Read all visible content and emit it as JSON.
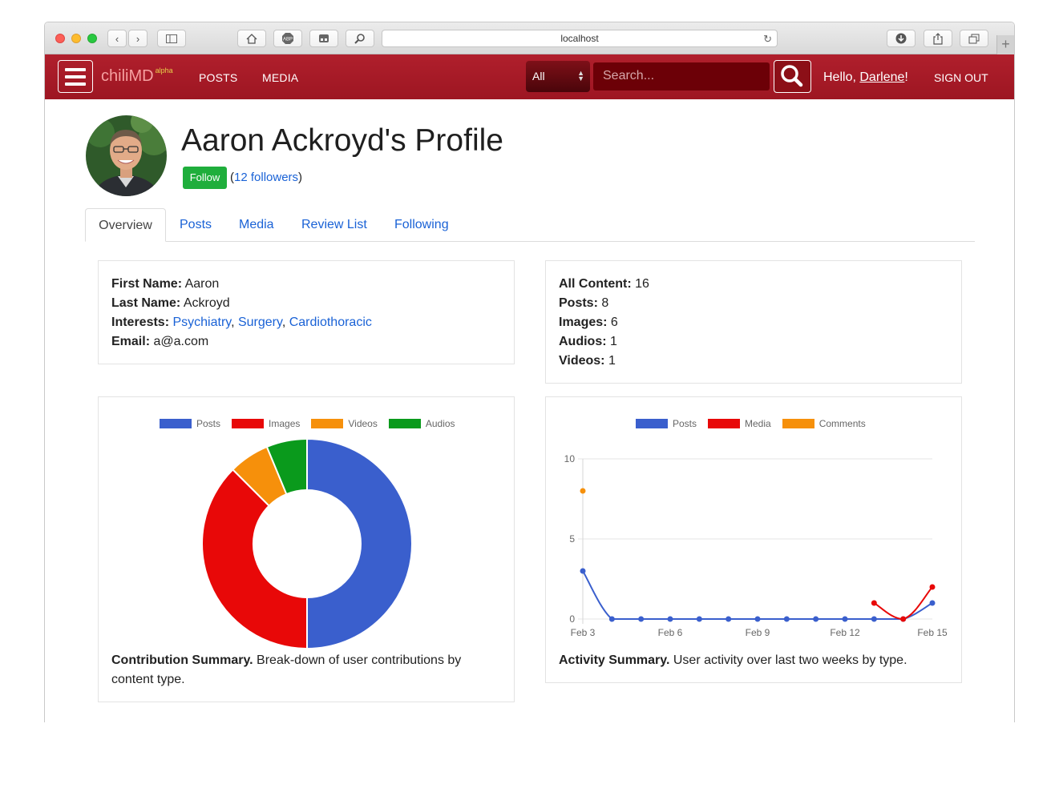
{
  "browser": {
    "url": "localhost"
  },
  "nav": {
    "brand": "chiliMD",
    "brand_tag": "alpha",
    "links": [
      "POSTS",
      "MEDIA"
    ],
    "filter": "All",
    "search_placeholder": "Search...",
    "hello_prefix": "Hello, ",
    "user": "Darlene",
    "hello_suffix": "!",
    "signout": "SIGN OUT",
    "color": "#a91b27"
  },
  "profile": {
    "title": "Aaron Ackroyd's Profile",
    "follow_label": "Follow",
    "followers_link": "12 followers"
  },
  "tabs": [
    "Overview",
    "Posts",
    "Media",
    "Review List",
    "Following"
  ],
  "details": {
    "first_name_label": "First Name:",
    "first_name": "Aaron",
    "last_name_label": "Last Name:",
    "last_name": "Ackroyd",
    "interests_label": "Interests:",
    "interests": [
      "Psychiatry",
      "Surgery",
      "Cardiothoracic"
    ],
    "email_label": "Email:",
    "email": "a@a.com"
  },
  "stats": [
    {
      "label": "All Content:",
      "value": "16"
    },
    {
      "label": "Posts:",
      "value": "8"
    },
    {
      "label": "Images:",
      "value": "6"
    },
    {
      "label": "Audios:",
      "value": "1"
    },
    {
      "label": "Videos:",
      "value": "1"
    }
  ],
  "captions": {
    "contribution_bold": "Contribution Summary.",
    "contribution_text": " Break-down of user contributions by content type.",
    "activity_bold": "Activity Summary.",
    "activity_text": " User activity over last two weeks by type."
  },
  "chart_data": [
    {
      "type": "pie",
      "categories": [
        "Posts",
        "Images",
        "Videos",
        "Audios"
      ],
      "values": [
        8,
        6,
        1,
        1
      ],
      "colors": [
        "#3a5fcd",
        "#e80808",
        "#f6900b",
        "#0a9a1c"
      ],
      "legend": "top"
    },
    {
      "type": "line",
      "x": [
        "Feb 3",
        "Feb 4",
        "Feb 5",
        "Feb 6",
        "Feb 7",
        "Feb 8",
        "Feb 9",
        "Feb 10",
        "Feb 11",
        "Feb 12",
        "Feb 13",
        "Feb 14",
        "Feb 15"
      ],
      "x_ticks": [
        "Feb 3",
        "Feb 6",
        "Feb 9",
        "Feb 12",
        "Feb 15"
      ],
      "y_ticks": [
        0,
        5,
        10
      ],
      "ylim": [
        0,
        10
      ],
      "grid": true,
      "legend": "top",
      "series": [
        {
          "name": "Posts",
          "color": "#3a5fcd",
          "values": [
            3,
            0,
            0,
            0,
            0,
            0,
            0,
            0,
            0,
            0,
            0,
            0,
            1
          ]
        },
        {
          "name": "Media",
          "color": "#e80808",
          "values": [
            null,
            null,
            null,
            null,
            null,
            null,
            null,
            null,
            null,
            null,
            1,
            0,
            2
          ]
        },
        {
          "name": "Comments",
          "color": "#f6900b",
          "values": [
            8,
            null,
            null,
            null,
            null,
            null,
            null,
            null,
            null,
            null,
            null,
            null,
            null
          ]
        }
      ]
    }
  ]
}
